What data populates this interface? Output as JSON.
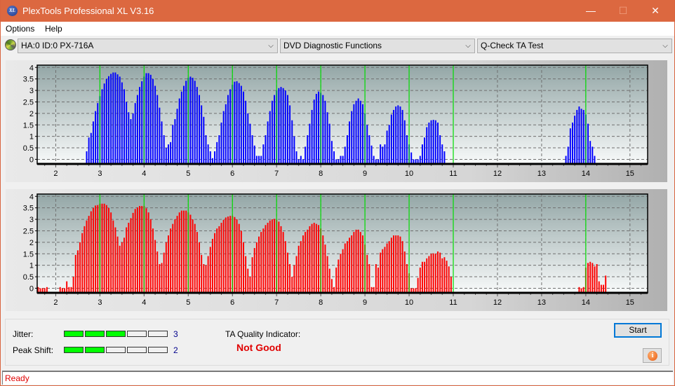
{
  "window": {
    "title": "PlexTools Professional XL V3.16",
    "app_icon": "XL",
    "minimize": "—",
    "maximize": "☐",
    "close": "✕"
  },
  "menu": {
    "items": [
      "Options",
      "Help"
    ]
  },
  "toolbar": {
    "drive_combo": "HA:0 ID:0  PX-716A",
    "function_combo": "DVD Diagnostic Functions",
    "test_combo": "Q-Check TA Test",
    "chevron": "⌵"
  },
  "chart_data": [
    {
      "type": "bar",
      "name": "TA distribution (land/top)",
      "color": "#0000ff",
      "x_ticks": [
        2,
        3,
        4,
        5,
        6,
        7,
        8,
        9,
        10,
        11,
        12,
        13,
        14,
        15
      ],
      "y_ticks": [
        "0",
        "0.5",
        "1",
        "1.5",
        "2",
        "2.5",
        "3",
        "3.5",
        "4"
      ],
      "xlim": [
        1.58,
        15.4
      ],
      "ylim": [
        -0.2,
        4.1
      ],
      "reference_lines_x": [
        3,
        4,
        5,
        6,
        7,
        8,
        9,
        10,
        11,
        14
      ],
      "reference_line_color": "#00dd00",
      "grid": true,
      "bar_step": 0.05,
      "groups": [
        {
          "start": 2.7,
          "values": [
            0.35,
            0.95,
            1.15,
            1.65,
            2.1,
            2.45,
            2.75,
            3.05,
            3.3,
            3.5,
            3.62,
            3.72,
            3.78,
            3.78,
            3.7,
            3.6,
            3.35,
            3.05,
            2.5,
            2.05,
            1.75,
            2.0,
            2.45,
            2.8,
            3.15,
            3.4,
            3.6,
            3.75,
            3.75,
            3.68,
            3.5,
            3.2,
            2.8,
            2.25,
            1.65,
            1.05,
            0.5,
            0.65,
            0.75,
            1.5,
            1.75,
            2.2,
            2.65,
            2.95,
            3.2,
            3.42,
            3.55,
            3.6,
            3.55,
            3.42,
            3.15,
            2.8,
            2.35,
            1.85,
            1.05,
            0.65,
            0.35,
            0.05,
            0.35,
            0.75,
            1.05,
            1.6,
            2.1,
            2.4,
            2.8,
            3.05,
            3.25,
            3.38,
            3.4,
            3.32,
            3.2,
            2.95,
            2.55,
            2.0,
            1.55,
            1.05,
            0.6,
            0.15,
            0.15,
            0.15,
            0.65,
            1.05,
            1.65,
            2.1,
            2.55,
            2.8,
            3.0,
            3.1,
            3.15,
            3.1,
            3.0,
            2.8,
            2.35,
            1.7,
            1.0,
            0.35,
            0.0,
            0.15,
            0.0,
            0.55,
            1.05,
            1.55,
            2.15,
            2.6,
            2.85,
            2.95,
            2.9,
            2.8,
            2.55,
            2.05,
            1.55,
            0.8,
            0.35,
            0.0,
            0.0,
            0.15,
            0.15,
            0.55,
            1.05,
            1.65,
            2.1,
            2.4,
            2.55,
            2.65,
            2.55,
            2.4,
            2.0,
            1.5,
            1.05,
            0.6,
            0.15,
            0.0,
            0.0,
            0.65,
            0.55,
            0.65,
            1.25,
            1.5,
            1.95,
            2.15,
            2.3,
            2.35,
            2.3,
            2.15,
            1.7,
            1.05,
            0.65,
            0.3,
            0.0,
            0.0,
            0.0,
            0.15,
            0.65,
            0.95,
            1.4,
            1.6,
            1.7,
            1.72,
            1.7,
            1.6,
            1.05,
            0.65,
            0.35
          ]
        },
        {
          "start": 13.55,
          "values": [
            0.15,
            0.55,
            1.35,
            1.6,
            1.9,
            2.15,
            2.3,
            2.2,
            2.15,
            1.95,
            1.55,
            0.8,
            0.55,
            0.15
          ]
        }
      ]
    },
    {
      "type": "bar",
      "name": "TA distribution (pit/bottom)",
      "color": "#ff0000",
      "x_ticks": [
        2,
        3,
        4,
        5,
        6,
        7,
        8,
        9,
        10,
        11,
        12,
        13,
        14,
        15
      ],
      "y_ticks": [
        "0",
        "0.5",
        "1",
        "1.5",
        "2",
        "2.5",
        "3",
        "3.5",
        "4"
      ],
      "xlim": [
        1.58,
        15.4
      ],
      "ylim": [
        -0.2,
        4.1
      ],
      "reference_lines_x": [
        3,
        4,
        5,
        6,
        7,
        8,
        9,
        10,
        11,
        14
      ],
      "reference_line_color": "#00dd00",
      "grid": true,
      "bar_step": 0.05,
      "groups": [
        {
          "start": 1.6,
          "values": [
            0.05,
            0.0,
            0.0,
            0.0,
            0.05
          ]
        },
        {
          "start": 2.1,
          "values": [
            0.05,
            0.0,
            0.0,
            0.3,
            0.05,
            0.05,
            0.5,
            1.45,
            1.65,
            2.0,
            2.4,
            2.7,
            2.95,
            3.15,
            3.35,
            3.5,
            3.6,
            3.62,
            3.68,
            3.68,
            3.68,
            3.62,
            3.5,
            3.3,
            2.95,
            2.65,
            2.25,
            1.85,
            2.0,
            2.2,
            2.65,
            2.85,
            3.05,
            3.28,
            3.45,
            3.52,
            3.58,
            3.58,
            3.58,
            3.48,
            3.3,
            3.0,
            2.6,
            2.1,
            1.6,
            1.05,
            1.1,
            1.55,
            2.0,
            2.3,
            2.6,
            2.8,
            3.0,
            3.15,
            3.3,
            3.38,
            3.38,
            3.38,
            3.3,
            3.2,
            3.0,
            2.8,
            2.45,
            2.0,
            1.45,
            1.05,
            1.0,
            1.4,
            1.8,
            2.15,
            2.4,
            2.6,
            2.7,
            2.85,
            2.98,
            3.08,
            3.12,
            3.15,
            3.15,
            3.1,
            3.0,
            2.8,
            2.5,
            2.0,
            1.4,
            0.85,
            0.5,
            1.35,
            1.75,
            2.0,
            2.25,
            2.45,
            2.6,
            2.75,
            2.85,
            2.95,
            3.0,
            3.02,
            2.98,
            2.9,
            2.7,
            2.45,
            2.05,
            1.55,
            1.05,
            0.5,
            1.0,
            1.4,
            1.85,
            2.05,
            2.3,
            2.45,
            2.55,
            2.7,
            2.8,
            2.85,
            2.8,
            2.75,
            2.6,
            2.3,
            1.9,
            1.4,
            0.85,
            0.4,
            0.05,
            0.9,
            1.25,
            1.5,
            1.7,
            1.95,
            2.05,
            2.2,
            2.3,
            2.45,
            2.55,
            2.55,
            2.45,
            2.3,
            1.9,
            1.45,
            1.05,
            0.05,
            0.05,
            1.05,
            0.9,
            1.55,
            1.7,
            1.8,
            1.95,
            2.05,
            2.2,
            2.3,
            2.3,
            2.3,
            2.25,
            2.05,
            1.6,
            1.05,
            0.65,
            0.0,
            0.0,
            0.0,
            0.45,
            0.9,
            1.15,
            1.15,
            1.3,
            1.4,
            1.5,
            1.52,
            1.5,
            1.6,
            1.55,
            1.3,
            1.35,
            1.2,
            0.95,
            0.5
          ]
        },
        {
          "start": 13.85,
          "values": [
            0.05,
            0.0,
            0.05,
            0.9,
            1.1,
            1.15,
            1.1,
            0.95,
            1.05,
            0.3,
            0.15,
            0.15,
            0.55
          ]
        }
      ]
    }
  ],
  "results": {
    "jitter_label": "Jitter:",
    "jitter_value": "3",
    "jitter_level": 3,
    "peak_shift_label": "Peak Shift:",
    "peak_shift_value": "2",
    "peak_shift_level": 2,
    "meter_segments": 5,
    "meter_on_color": "#00ff00",
    "ta_quality_label": "TA Quality Indicator:",
    "ta_quality_value": "Not Good",
    "start_button": "Start",
    "info_button": "i"
  },
  "status": {
    "text": "Ready"
  }
}
